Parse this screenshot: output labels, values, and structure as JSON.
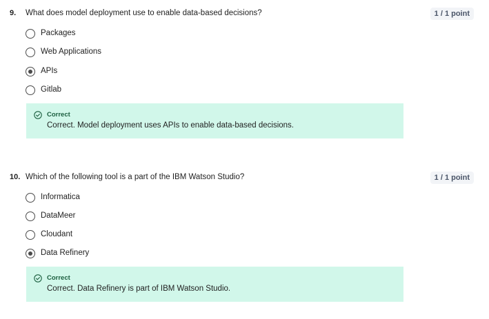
{
  "questions": [
    {
      "number": "9.",
      "text": "What does model deployment use to enable data-based decisions?",
      "points": "1 / 1 point",
      "options": [
        {
          "label": "Packages",
          "selected": false
        },
        {
          "label": "Web Applications",
          "selected": false
        },
        {
          "label": "APIs",
          "selected": true
        },
        {
          "label": "Gitlab",
          "selected": false
        }
      ],
      "feedback": {
        "status": "Correct",
        "text": "Correct. Model deployment uses APIs to enable data-based decisions."
      }
    },
    {
      "number": "10.",
      "text": "Which of the following tool is a part of the IBM Watson Studio?",
      "points": "1 / 1 point",
      "options": [
        {
          "label": "Informatica",
          "selected": false
        },
        {
          "label": "DataMeer",
          "selected": false
        },
        {
          "label": "Cloudant",
          "selected": false
        },
        {
          "label": "Data Refinery",
          "selected": true
        }
      ],
      "feedback": {
        "status": "Correct",
        "text": "Correct. Data Refinery is part of IBM Watson Studio."
      }
    }
  ],
  "icons": {
    "feedback_icon": "check-circle-icon"
  },
  "colors": {
    "correct_bg": "#d1f7ea",
    "correct_title": "#1b5e3f",
    "points_bg": "#f2f4f7"
  }
}
